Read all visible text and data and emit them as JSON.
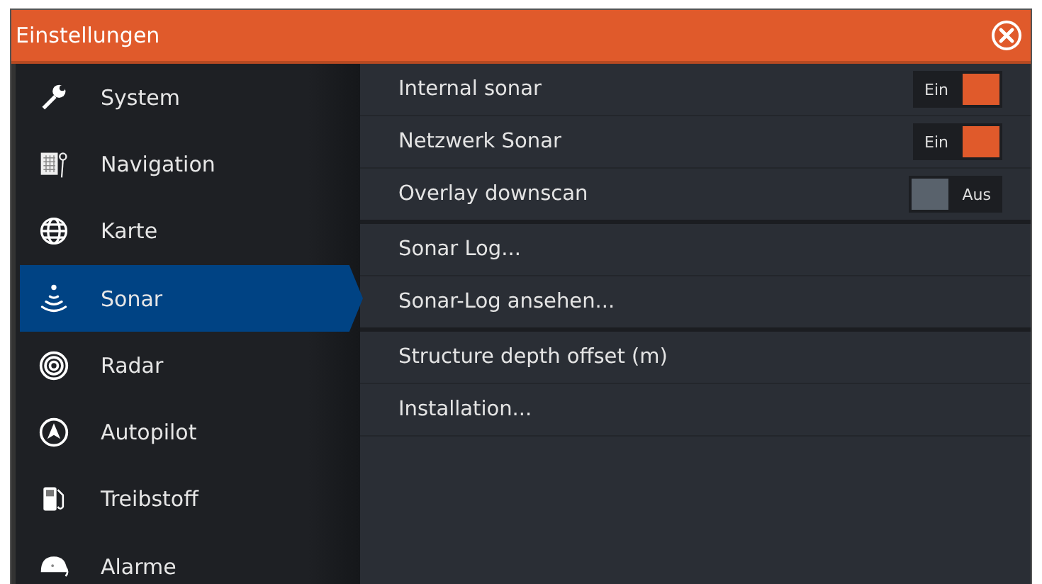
{
  "window": {
    "title": "Einstellungen"
  },
  "sidebar": {
    "items": [
      {
        "label": "System",
        "selected": false
      },
      {
        "label": "Navigation",
        "selected": false
      },
      {
        "label": "Karte",
        "selected": false
      },
      {
        "label": "Sonar",
        "selected": true
      },
      {
        "label": "Radar",
        "selected": false
      },
      {
        "label": "Autopilot",
        "selected": false
      },
      {
        "label": "Treibstoff",
        "selected": false
      },
      {
        "label": "Alarme",
        "selected": false
      }
    ]
  },
  "settings": [
    {
      "kind": "toggle",
      "label": "Internal sonar",
      "on": true,
      "state_text": "Ein",
      "group_end": false
    },
    {
      "kind": "toggle",
      "label": "Netzwerk Sonar",
      "on": true,
      "state_text": "Ein",
      "group_end": false
    },
    {
      "kind": "toggle",
      "label": "Overlay downscan",
      "on": false,
      "state_text": "Aus",
      "group_end": true
    },
    {
      "kind": "action",
      "label": "Sonar Log...",
      "group_end": false
    },
    {
      "kind": "action",
      "label": "Sonar-Log ansehen...",
      "group_end": true
    },
    {
      "kind": "action",
      "label": "Structure depth offset (m)",
      "group_end": false
    },
    {
      "kind": "action",
      "label": "Installation...",
      "group_end": false
    }
  ]
}
